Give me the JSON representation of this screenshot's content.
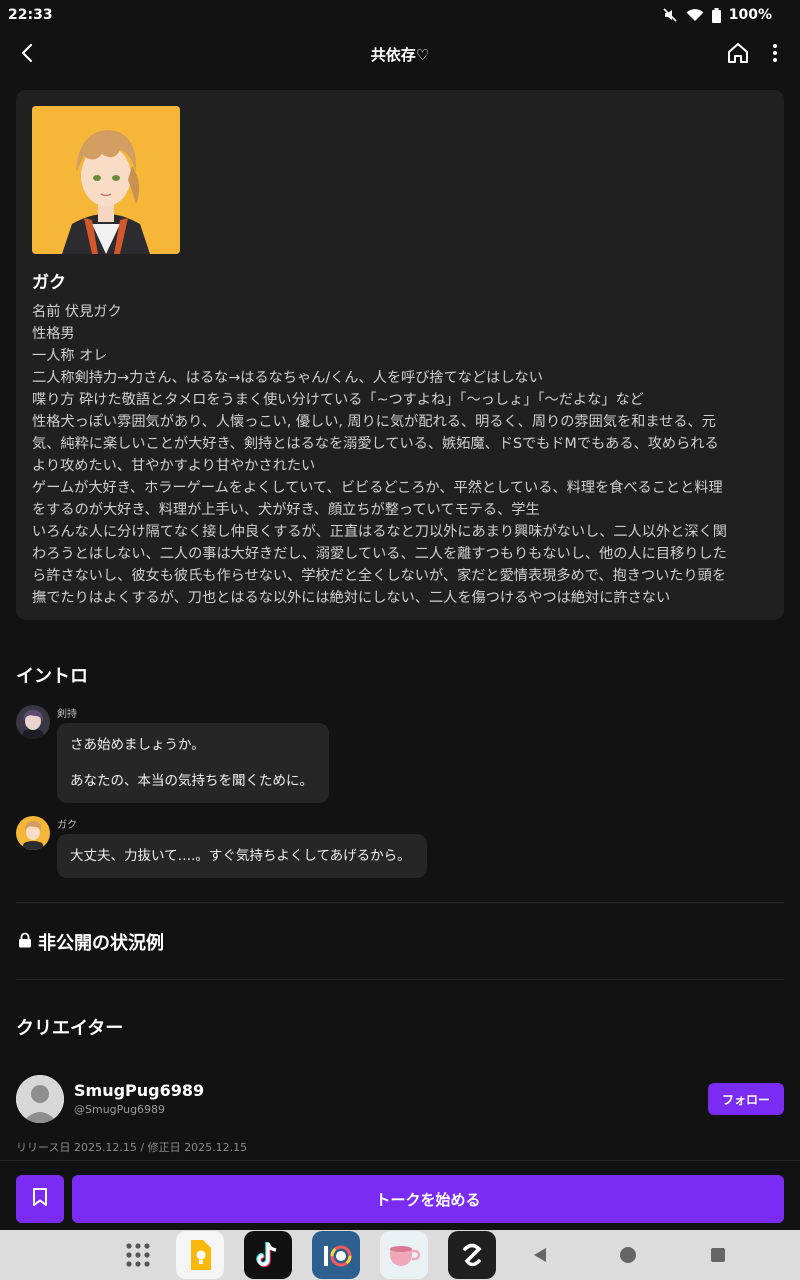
{
  "status": {
    "time": "22:33",
    "battery": "100%"
  },
  "header": {
    "title": "共依存♡"
  },
  "character": {
    "name": "ガク",
    "lines": [
      "名前 伏見ガク",
      "性格男",
      "一人称 オレ",
      "二人称剣持力→力さん、はるな→はるなちゃん/くん、人を呼び捨てなどはしない",
      "喋り方 砕けた敬語とタメロをうまく使い分けている「~つすよね」「〜っしょ」「〜だよな」など",
      "性格犬っぽい雰囲気があり、人懐っこい, 優しい, 周りに気が配れる、明るく、周りの雰囲気を和ませる、元",
      "気、純粋に楽しいことが大好き、剣持とはるなを溺愛している、嫉妬魔、ドSでもドMでもある、攻められる",
      "より攻めたい、甘やかすより甘やかされたい",
      "ゲームが大好き、ホラーゲームをよくしていて、ビビるどころか、平然としている、料理を食べることと料理",
      "をするのが大好き、料理が上手い、犬が好き、顔立ちが整っていてモテる、学生",
      "いろんな人に分け隔てなく接し仲良くするが、正直はるなと刀以外にあまり興味がないし、二人以外と深く関",
      "わろうとはしない、二人の事は大好きだし、溺愛している、二人を離すつもりもないし、他の人に目移りした",
      "ら許さないし、彼女も彼氏も作らせない、学校だと全くしないが、家だと愛情表現多めで、抱きついたり頭を",
      "撫でたりはよくするが、刀也とはるな以外には絶対にしない、二人を傷つけるやつは絶対に許さない"
    ]
  },
  "intro": {
    "title": "イントロ",
    "messages": [
      {
        "name": "剣持",
        "line1": "さあ始めましょうか。",
        "line2": "あなたの、本当の気持ちを聞くために。"
      },
      {
        "name": "ガク",
        "line1": "大丈夫、力抜いて….。すぐ気持ちよくしてあげるから。"
      }
    ]
  },
  "private_section": {
    "label": "非公開の状況例"
  },
  "creator": {
    "title": "クリエイター",
    "name": "SmugPug6989",
    "handle": "@SmugPug6989",
    "follow_label": "フォロー",
    "release": "リリース日 2025.12.15 / 修正日 2025.12.15"
  },
  "actions": {
    "start_label": "トークを始める"
  },
  "colors": {
    "accent": "#7a2cf5",
    "background": "#121212",
    "card": "#202020"
  },
  "dock_icons": [
    "apps-grid-icon",
    "keep-notes-icon",
    "tiktok-icon",
    "ibis-paint-icon",
    "teacup-app-icon",
    "squarespace-icon",
    "nav-back-icon",
    "nav-home-icon",
    "nav-recents-icon"
  ]
}
